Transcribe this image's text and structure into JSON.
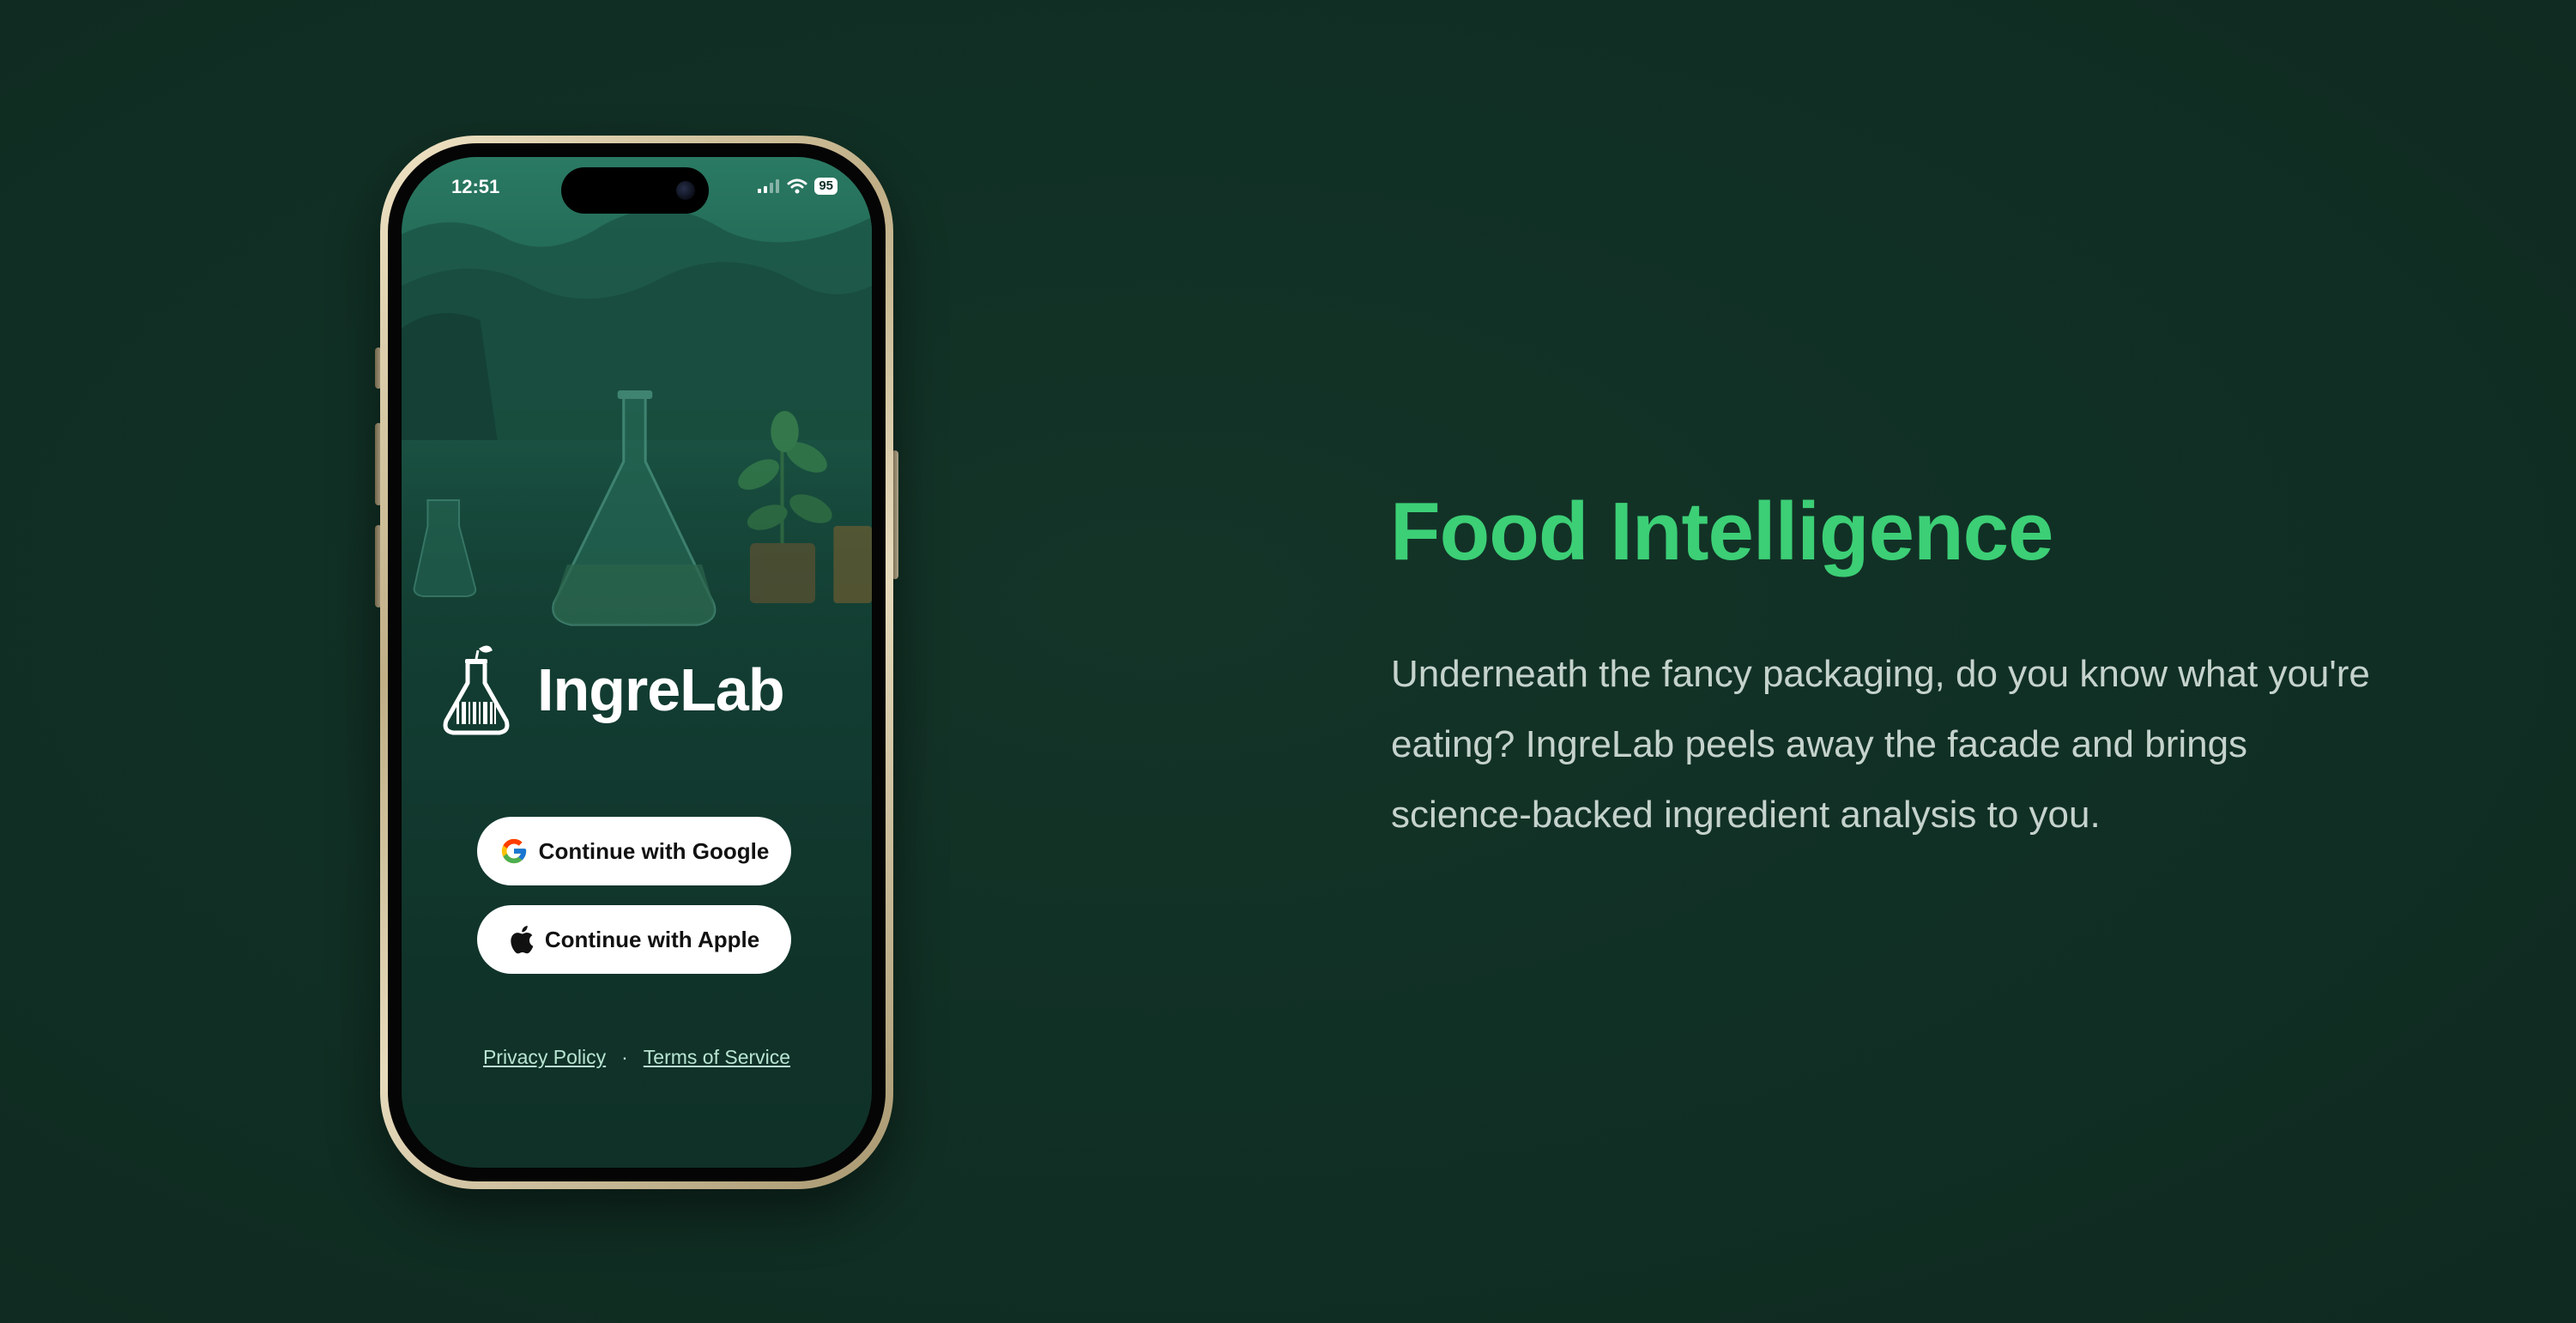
{
  "phone": {
    "status_time": "12:51",
    "battery": "95",
    "app_name": "IngreLab",
    "buttons": {
      "google_label": "Continue with Google",
      "apple_label": "Continue with Apple"
    },
    "links": {
      "privacy": "Privacy Policy",
      "separator": "·",
      "terms": "Terms of Service"
    },
    "icons": {
      "signal": "signal-icon",
      "wifi": "wifi-icon",
      "logo": "flask-barcode-logo-icon",
      "google": "google-icon",
      "apple": "apple-icon"
    }
  },
  "hero": {
    "title": "Food Intelligence",
    "body": "Underneath the fancy packaging, do you know what you're eating? IngreLab peels away the facade and brings science-backed ingredient analysis to you."
  },
  "colors": {
    "background": "#113025",
    "accent": "#3ccf76",
    "body_text": "#c5d3cc",
    "phone_frame": "#d8c9a4"
  }
}
